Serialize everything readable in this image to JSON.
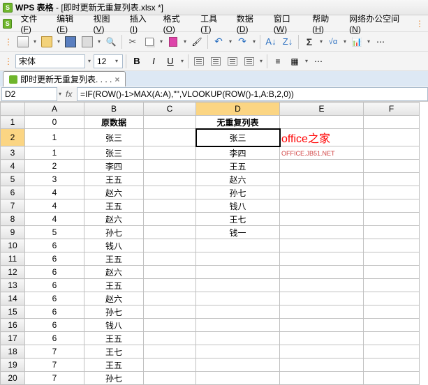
{
  "titlebar": {
    "app": "WPS 表格",
    "doc": "- [即时更新无重复列表.xlsx *]"
  },
  "menu": {
    "items": [
      {
        "label": "文件",
        "key": "F"
      },
      {
        "label": "编辑",
        "key": "E"
      },
      {
        "label": "视图",
        "key": "V"
      },
      {
        "label": "插入",
        "key": "I"
      },
      {
        "label": "格式",
        "key": "O"
      },
      {
        "label": "工具",
        "key": "T"
      },
      {
        "label": "数据",
        "key": "D"
      },
      {
        "label": "窗口",
        "key": "W"
      },
      {
        "label": "帮助",
        "key": "H"
      },
      {
        "label": "网络办公空间",
        "key": "N"
      }
    ]
  },
  "format": {
    "font": "宋体",
    "size": "12",
    "bold": "B",
    "italic": "I",
    "underline": "U"
  },
  "tab": {
    "name": "即时更新无重复列表. . . .",
    "close": "×"
  },
  "cellref": "D2",
  "formula": "=IF(ROW()-1>MAX(A:A),\"\",VLOOKUP(ROW()-1,A:B,2,0))",
  "columns": [
    "A",
    "B",
    "C",
    "D",
    "E",
    "F"
  ],
  "headers": {
    "A": "0",
    "B": "原数据",
    "D": "无重复列表"
  },
  "rows": [
    {
      "n": 1,
      "A": "0",
      "B": "原数据",
      "D": "无重复列表"
    },
    {
      "n": 2,
      "A": "1",
      "B": "张三",
      "D": "张三"
    },
    {
      "n": 3,
      "A": "1",
      "B": "张三",
      "D": "李四"
    },
    {
      "n": 4,
      "A": "2",
      "B": "李四",
      "D": "王五"
    },
    {
      "n": 5,
      "A": "3",
      "B": "王五",
      "D": "赵六"
    },
    {
      "n": 6,
      "A": "4",
      "B": "赵六",
      "D": "孙七"
    },
    {
      "n": 7,
      "A": "4",
      "B": "王五",
      "D": "钱八"
    },
    {
      "n": 8,
      "A": "4",
      "B": "赵六",
      "D": "王七"
    },
    {
      "n": 9,
      "A": "5",
      "B": "孙七",
      "D": "钱一"
    },
    {
      "n": 10,
      "A": "6",
      "B": "钱八",
      "D": ""
    },
    {
      "n": 11,
      "A": "6",
      "B": "王五",
      "D": ""
    },
    {
      "n": 12,
      "A": "6",
      "B": "赵六",
      "D": ""
    },
    {
      "n": 13,
      "A": "6",
      "B": "王五",
      "D": ""
    },
    {
      "n": 14,
      "A": "6",
      "B": "赵六",
      "D": ""
    },
    {
      "n": 15,
      "A": "6",
      "B": "孙七",
      "D": ""
    },
    {
      "n": 16,
      "A": "6",
      "B": "钱八",
      "D": ""
    },
    {
      "n": 17,
      "A": "6",
      "B": "王五",
      "D": ""
    },
    {
      "n": 18,
      "A": "7",
      "B": "王七",
      "D": ""
    },
    {
      "n": 19,
      "A": "7",
      "B": "王五",
      "D": ""
    },
    {
      "n": 20,
      "A": "7",
      "B": "孙七",
      "D": ""
    }
  ],
  "watermark": {
    "line1": "office之家",
    "line2": "OFFICE.JB51.NET"
  },
  "selected": {
    "row": 2,
    "col": "D"
  }
}
